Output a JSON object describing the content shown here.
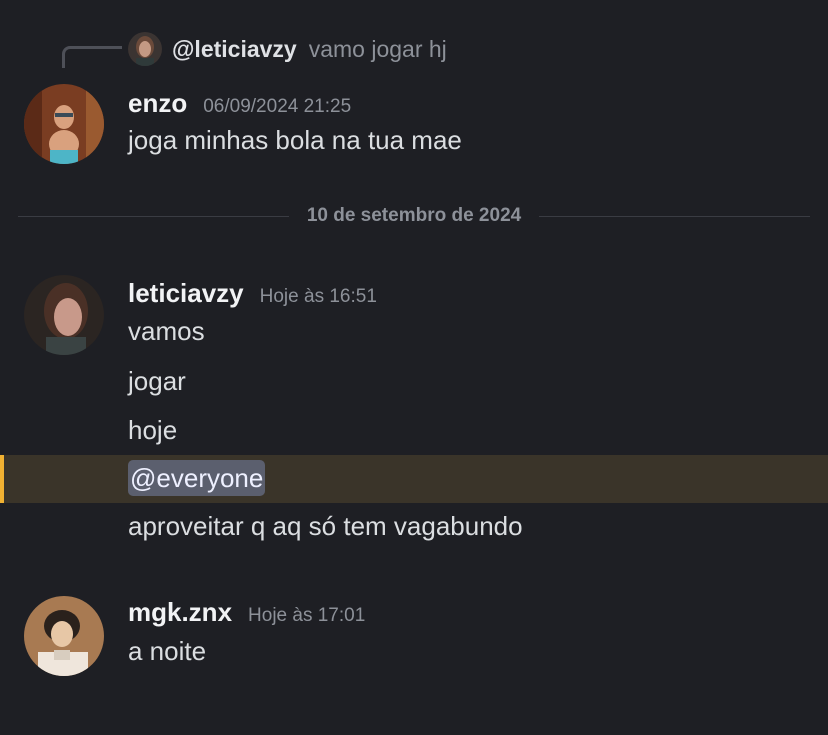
{
  "reply": {
    "mention": "@leticiavzy",
    "text": "vamo jogar hj"
  },
  "messages": [
    {
      "username": "enzo",
      "timestamp": "06/09/2024 21:25",
      "lines": [
        "joga minhas bola na tua mae"
      ]
    },
    {
      "username": "leticiavzy",
      "timestamp": "Hoje às 16:51",
      "lines": [
        "vamos",
        "jogar",
        "hoje",
        "@everyone",
        "aproveitar q aq só tem vagabundo"
      ]
    },
    {
      "username": "mgk.znx",
      "timestamp": "Hoje às 17:01",
      "lines": [
        "a noite"
      ]
    }
  ],
  "divider": {
    "date": "10 de setembro de 2024"
  },
  "colors": {
    "background": "#1e1f24",
    "mention_highlight": "#3a3429",
    "mention_bar": "#f0b132",
    "mention_pill": "#5b5f6e"
  }
}
